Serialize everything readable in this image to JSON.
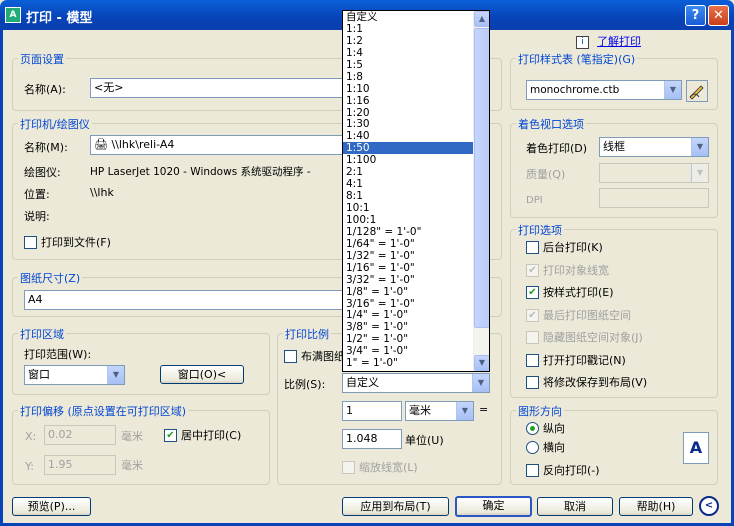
{
  "window": {
    "title": "打印 - 模型",
    "app_icon_text": "A",
    "help_btn": "?",
    "close_btn": "✕"
  },
  "help_link": {
    "icon": "i",
    "label": "了解打印"
  },
  "page_setup": {
    "legend": "页面设置",
    "name_label": "名称(A):",
    "name_value": "<无>"
  },
  "printer": {
    "legend": "打印机/绘图仪",
    "name_label": "名称(M):",
    "name_value": "\\\\lhk\\reli-A4",
    "plotter_label": "绘图仪:",
    "plotter_value": "HP LaserJet 1020 - Windows 系统驱动程序 -",
    "location_label": "位置:",
    "location_value": "\\\\lhk",
    "desc_label": "说明:",
    "print_to_file": "打印到文件(F)"
  },
  "paper_size": {
    "legend": "图纸尺寸(Z)",
    "value": "A4"
  },
  "print_area": {
    "legend": "打印区域",
    "range_label": "打印范围(W):",
    "range_value": "窗口",
    "window_button": "窗口(O)<"
  },
  "plot_offset": {
    "legend": "打印偏移 (原点设置在可打印区域)",
    "x_label": "X:",
    "x_value": "0.02",
    "x_unit": "毫米",
    "y_label": "Y:",
    "y_value": "1.95",
    "y_unit": "毫米",
    "center_label": "居中打印(C)"
  },
  "plot_scale": {
    "legend": "打印比例",
    "fit_label": "布满图纸",
    "scale_label": "比例(S):",
    "scale_value": "自定义",
    "value1": "1",
    "unit_value": "毫米",
    "equals": "=",
    "value2": "1.048",
    "unit_label": "单位(U)",
    "lineweights_label": "缩放线宽(L)"
  },
  "scale_list": {
    "items": [
      "自定义",
      "1:1",
      "1:2",
      "1:4",
      "1:5",
      "1:8",
      "1:10",
      "1:16",
      "1:20",
      "1:30",
      "1:40",
      "1:50",
      "1:100",
      "2:1",
      "4:1",
      "8:1",
      "10:1",
      "100:1",
      "1/128\" = 1'-0\"",
      "1/64\" = 1'-0\"",
      "1/32\" = 1'-0\"",
      "1/16\" = 1'-0\"",
      "3/32\" = 1'-0\"",
      "1/8\" = 1'-0\"",
      "3/16\" = 1'-0\"",
      "1/4\" = 1'-0\"",
      "3/8\" = 1'-0\"",
      "1/2\" = 1'-0\"",
      "3/4\" = 1'-0\"",
      "1\" = 1'-0\""
    ],
    "selected": "1:50"
  },
  "plot_style": {
    "legend": "打印样式表 (笔指定)(G)",
    "value": "monochrome.ctb"
  },
  "shaded_viewport": {
    "legend": "着色视口选项",
    "shade_label": "着色打印(D)",
    "shade_value": "线框",
    "quality_label": "质量(Q)",
    "dpi_label": "DPI"
  },
  "plot_options": {
    "legend": "打印选项",
    "items": [
      {
        "label": "后台打印(K)",
        "checked": false,
        "disabled": false
      },
      {
        "label": "打印对象线宽",
        "checked": true,
        "disabled": true
      },
      {
        "label": "按样式打印(E)",
        "checked": true,
        "disabled": false
      },
      {
        "label": "最后打印图纸空间",
        "checked": true,
        "disabled": true
      },
      {
        "label": "隐藏图纸空间对象(J)",
        "checked": false,
        "disabled": true
      },
      {
        "label": "打开打印戳记(N)",
        "checked": false,
        "disabled": false
      },
      {
        "label": "将修改保存到布局(V)",
        "checked": false,
        "disabled": false
      }
    ]
  },
  "orientation": {
    "legend": "图形方向",
    "portrait": "纵向",
    "landscape": "横向",
    "upside_down": "反向打印(-)",
    "page_letter": "A"
  },
  "buttons": {
    "preview": "预览(P)...",
    "apply": "应用到布局(T)",
    "ok": "确定",
    "cancel": "取消",
    "help": "帮助(H)",
    "expand": "<"
  },
  "colors": {
    "titlebar": "#0843b8",
    "legend_text": "#0046d5",
    "selection": "#316ac5",
    "face": "#ece9d8"
  }
}
